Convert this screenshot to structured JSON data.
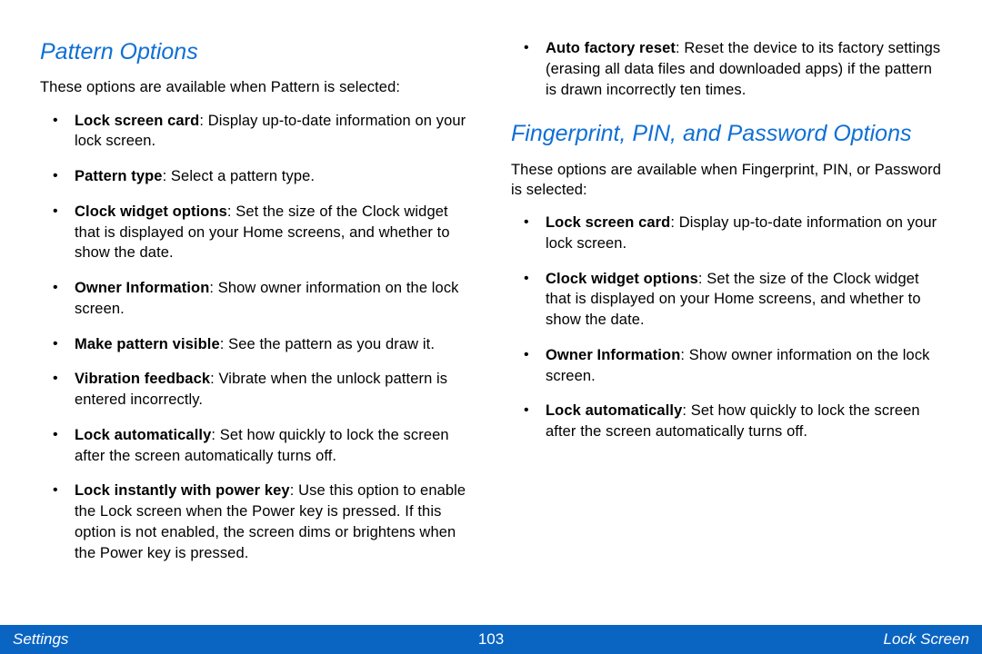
{
  "footer": {
    "left": "Settings",
    "center": "103",
    "right": "Lock Screen"
  },
  "left": {
    "heading": "Pattern Options",
    "intro": "These options are available when Pattern is selected:",
    "items": [
      {
        "term": "Lock screen card",
        "desc": ": Display up-to-date information on your lock screen."
      },
      {
        "term": "Pattern type",
        "desc": ": Select a pattern type."
      },
      {
        "term": "Clock widget options",
        "desc": ": Set the size of the Clock widget that is displayed on your Home screens, and whether to show the date."
      },
      {
        "term": "Owner Information",
        "desc": ": Show owner information on the lock screen."
      },
      {
        "term": "Make pattern visible",
        "desc": ": See the pattern as you draw it."
      },
      {
        "term": "Vibration feedback",
        "desc": ": Vibrate when the unlock pattern is entered incorrectly."
      },
      {
        "term": "Lock automatically",
        "desc": ": Set how quickly to lock the screen after the screen automatically turns off."
      },
      {
        "term": "Lock instantly with power key",
        "desc": ": Use this option to enable the Lock screen when the Power key is pressed. If this option is not enabled, the screen dims or brightens when the Power key is pressed."
      }
    ]
  },
  "right": {
    "top_items": [
      {
        "term": "Auto factory reset",
        "desc": ": Reset the device to its factory settings (erasing all data files and downloaded apps) if the pattern is drawn incorrectly ten times."
      }
    ],
    "heading": "Fingerprint, PIN, and Password Options",
    "intro": "These options are available when Fingerprint, PIN, or Password is selected:",
    "items": [
      {
        "term": "Lock screen card",
        "desc": ": Display up-to-date information on your lock screen."
      },
      {
        "term": "Clock widget options",
        "desc": ": Set the size of the Clock widget that is displayed on your Home screens, and whether to show the date."
      },
      {
        "term": "Owner Information",
        "desc": ": Show owner information on the lock screen."
      },
      {
        "term": "Lock automatically",
        "desc": ": Set how quickly to lock the screen after the screen automatically turns off."
      }
    ]
  }
}
